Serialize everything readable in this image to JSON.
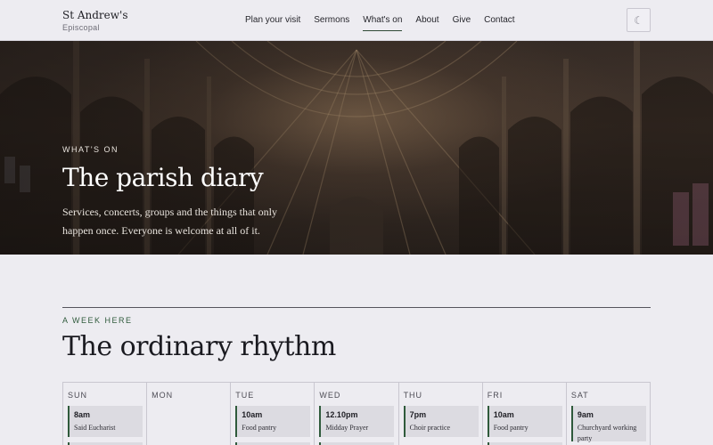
{
  "brand": {
    "name": "St Andrew's",
    "subtitle": "Episcopal"
  },
  "nav": [
    {
      "label": "Plan your visit"
    },
    {
      "label": "Sermons"
    },
    {
      "label": "What's on",
      "active": true
    },
    {
      "label": "About"
    },
    {
      "label": "Give"
    },
    {
      "label": "Contact"
    }
  ],
  "theme_toggle": {
    "icon": "moon-icon",
    "glyph": "☾"
  },
  "hero": {
    "eyebrow": "WHAT'S ON",
    "title": "The parish diary",
    "text": "Services, concerts, groups and the things that only happen once. Everyone is welcome at all of it."
  },
  "week": {
    "eyebrow": "A WEEK HERE",
    "title": "The ordinary rhythm",
    "days": [
      {
        "name": "SUN",
        "event": {
          "time": "8am",
          "name": "Said Eucharist"
        },
        "more": true
      },
      {
        "name": "MON",
        "event": null,
        "more": false
      },
      {
        "name": "TUE",
        "event": {
          "time": "10am",
          "name": "Food pantry"
        },
        "more": true
      },
      {
        "name": "WED",
        "event": {
          "time": "12.10pm",
          "name": "Midday Prayer"
        },
        "more": true
      },
      {
        "name": "THU",
        "event": {
          "time": "7pm",
          "name": "Choir practice"
        },
        "more": false
      },
      {
        "name": "FRI",
        "event": {
          "time": "10am",
          "name": "Food pantry"
        },
        "more": true
      },
      {
        "name": "SAT",
        "event": {
          "time": "9am",
          "name": "Churchyard working party"
        },
        "more": false
      }
    ]
  },
  "colors": {
    "accent": "#2f5a3b",
    "background": "#edecf1",
    "text": "#1e1e24"
  }
}
